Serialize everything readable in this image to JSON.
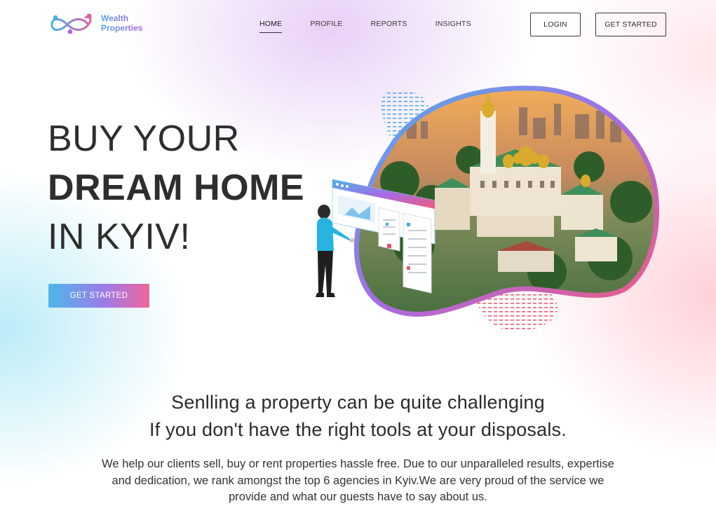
{
  "brand": {
    "line1": "Wealth",
    "line2": "Properties"
  },
  "nav": {
    "items": [
      {
        "label": "HOME",
        "active": true
      },
      {
        "label": "PROFILE",
        "active": false
      },
      {
        "label": "REPORTS",
        "active": false
      },
      {
        "label": "INSIGHTS",
        "active": false
      }
    ]
  },
  "header_actions": {
    "login_label": "LOGIN",
    "get_started_label": "GET STARTED"
  },
  "hero": {
    "line1": "BUY YOUR",
    "line2": "DREAM HOME",
    "line3": "IN KYIV!",
    "cta_label": "GET STARTED",
    "illustration_icon": "city-photo-with-woman-and-dashboard-icon"
  },
  "intro": {
    "heading_line1": "Senlling a property can be quite challenging",
    "heading_line2": "If you don't have the right tools at your disposals.",
    "body": "We help our clients sell, buy or rent properties hassle free. Due to our unparalleled results, expertise and dedication, we rank amongst the top 6 agencies in Kyiv.We are very proud of the service we provide and what our guests have to say about us."
  },
  "colors": {
    "gradient_start": "#4fb6ea",
    "gradient_mid": "#9a7ce8",
    "gradient_end": "#f0669a",
    "text": "#2b2b2b"
  }
}
